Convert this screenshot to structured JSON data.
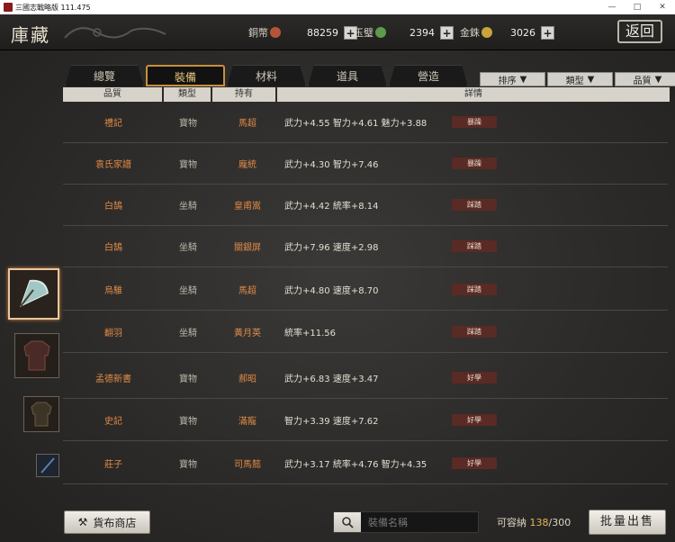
{
  "window": {
    "title": "三國志戰略版 111.475"
  },
  "header": {
    "title": "庫藏",
    "return_label": "返回",
    "currencies": [
      {
        "name": "銅幣",
        "value": "88259",
        "color": "#b4553a",
        "icon": "copper-coin-icon"
      },
      {
        "name": "玉璧",
        "value": "2394",
        "color": "#5c9a4c",
        "icon": "jade-icon"
      },
      {
        "name": "金銖",
        "value": "3026",
        "color": "#c9a23a",
        "icon": "gold-coin-icon"
      }
    ],
    "plus_label": "+"
  },
  "tabs": [
    {
      "label": "總覽",
      "active": false
    },
    {
      "label": "裝備",
      "active": true
    },
    {
      "label": "材料",
      "active": false
    },
    {
      "label": "道具",
      "active": false
    },
    {
      "label": "營造",
      "active": false
    }
  ],
  "filters": [
    {
      "label": "排序"
    },
    {
      "label": "類型"
    },
    {
      "label": "品質"
    }
  ],
  "columns": [
    "品質",
    "類型",
    "持有",
    "詳情"
  ],
  "rows": [
    {
      "name": "禮記",
      "type": "寶物",
      "owner": "馬超",
      "detail": "武力+4.55  智力+4.61  魅力+3.88",
      "tag": "暴躁"
    },
    {
      "name": "袁氏家譜",
      "type": "寶物",
      "owner": "龐統",
      "detail": "武力+4.30  智力+7.46",
      "tag": "暴躁"
    },
    {
      "name": "白鵠",
      "type": "坐騎",
      "owner": "皇甫嵩",
      "detail": "武力+4.42  統率+8.14",
      "tag": "踩踏"
    },
    {
      "name": "白鵠",
      "type": "坐騎",
      "owner": "關銀屏",
      "detail": "武力+7.96  速度+2.98",
      "tag": "踩踏"
    },
    {
      "name": "烏騅",
      "type": "坐騎",
      "owner": "馬超",
      "detail": "武力+4.80  速度+8.70",
      "tag": "踩踏"
    },
    {
      "name": "翻羽",
      "type": "坐騎",
      "owner": "黃月英",
      "detail": "統率+11.56",
      "tag": "踩踏"
    },
    {
      "name": "孟德新書",
      "type": "寶物",
      "owner": "郝昭",
      "detail": "武力+6.83  速度+3.47",
      "tag": "好學"
    },
    {
      "name": "史記",
      "type": "寶物",
      "owner": "滿寵",
      "detail": "智力+3.39  速度+7.62",
      "tag": "好學"
    },
    {
      "name": "莊子",
      "type": "寶物",
      "owner": "司馬懿",
      "detail": "武力+3.17  統率+4.76  智力+4.35",
      "tag": "好學"
    }
  ],
  "bottom": {
    "shop_label": "貨布商店",
    "search_placeholder": "裝備名稱",
    "capacity_label": "可容納",
    "capacity_current": "138",
    "capacity_total": "/300",
    "batch_sell_label": "批量出售"
  }
}
